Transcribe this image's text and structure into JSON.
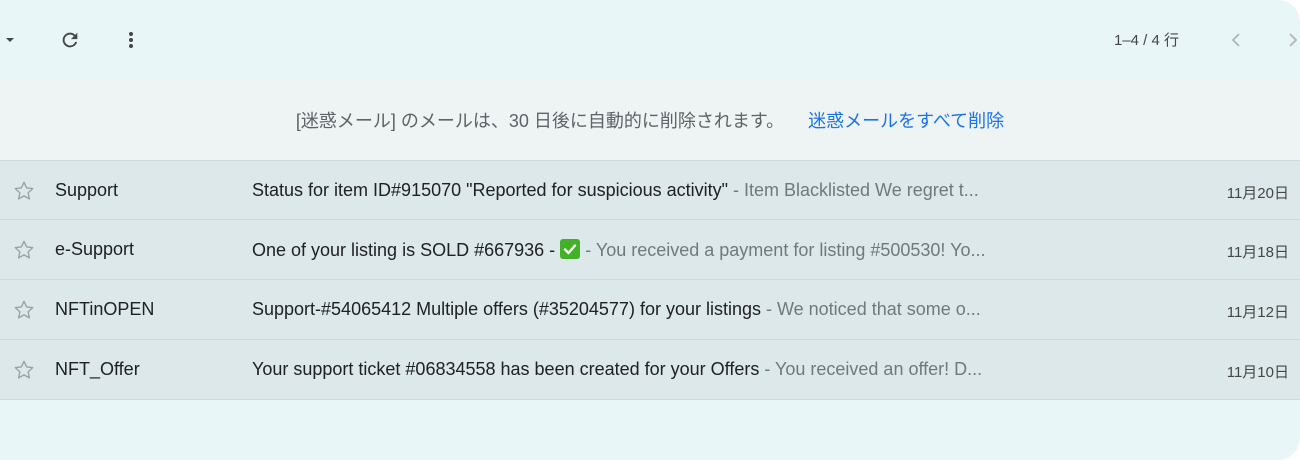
{
  "toolbar": {
    "count": "1–4 / 4 行"
  },
  "banner": {
    "text": "[迷惑メール] のメールは、30 日後に自動的に削除されます。",
    "link": "迷惑メールをすべて削除"
  },
  "emails": [
    {
      "sender": "Support",
      "subject": "Status for item ID#915070 \"Reported for suspicious activity\"",
      "snippet": "Item Blacklisted We regret t...",
      "date": "11月20日"
    },
    {
      "sender": "e-Support",
      "subject": "One of your listing is SOLD #667936 -",
      "snippet": "You received a payment for listing #500530! Yo...",
      "date": "11月18日"
    },
    {
      "sender": "NFTinOPEN",
      "subject": "Support-#54065412 Multiple offers (#35204577) for your listings",
      "snippet": "We noticed that some o...",
      "date": "11月12日"
    },
    {
      "sender": "NFT_Offer",
      "subject": "Your support ticket #06834558 has been created for your Offers",
      "snippet": "You received an offer! D...",
      "date": "11月10日"
    }
  ],
  "colors": {
    "background": "#e9f6f7",
    "banner_bg": "#eef3f3",
    "row_bg": "#dce8e9",
    "link": "#1a73e8",
    "check": "#43b02a"
  }
}
